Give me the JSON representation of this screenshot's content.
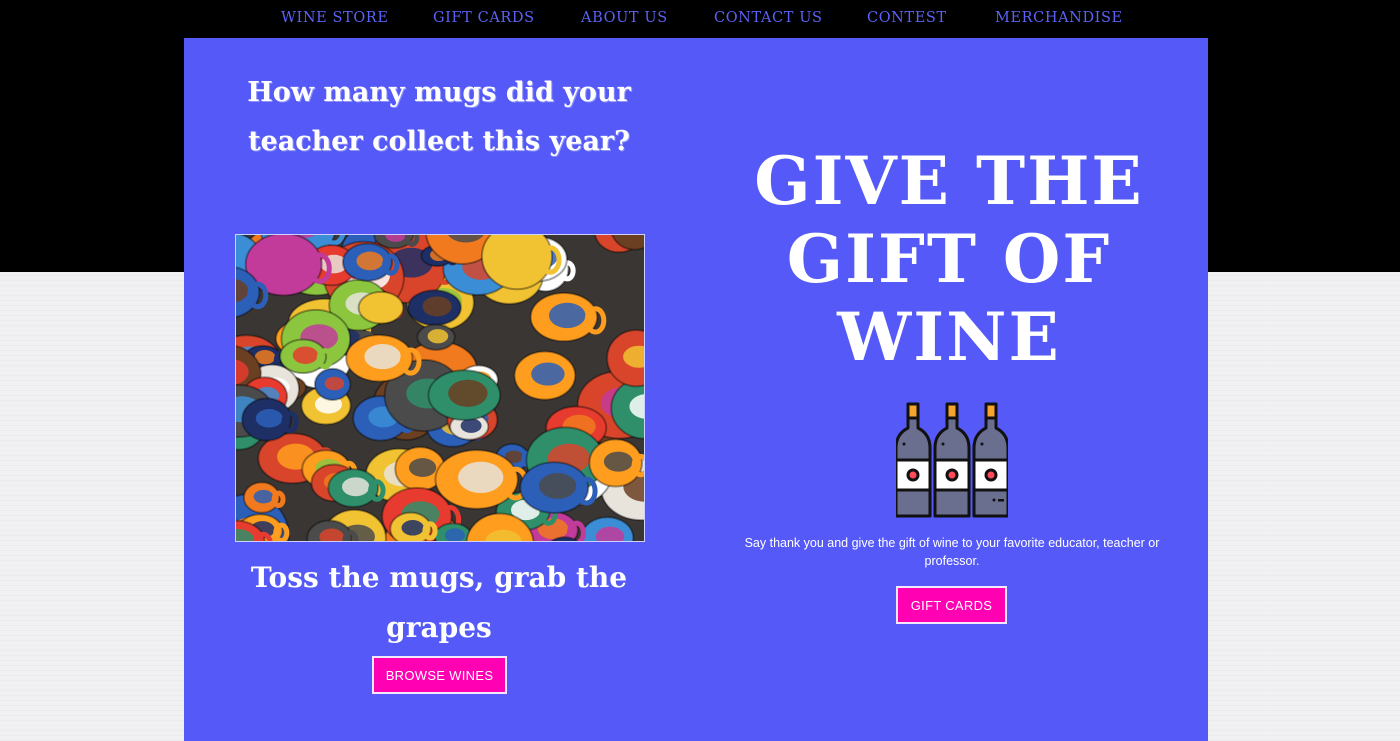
{
  "nav": {
    "items": [
      {
        "label": "WINE STORE"
      },
      {
        "label": "GIFT CARDS"
      },
      {
        "label": "ABOUT US"
      },
      {
        "label": "CONTACT US"
      },
      {
        "label": "CONTEST"
      },
      {
        "label": "MERCHANDISE"
      }
    ]
  },
  "left": {
    "question": "How many mugs did your teacher collect this year?",
    "tagline": "Toss the mugs, grab the grapes",
    "browse_button": "BROWSE WINES"
  },
  "right": {
    "hero_title": "GIVE THE GIFT OF WINE",
    "description": "Say thank you and give the gift of wine to your favorite educator, teacher or professor.",
    "gift_button": "GIFT CARDS"
  },
  "colors": {
    "panel": "#5459f7",
    "nav_text": "#5b62f5",
    "button": "#ff00b3",
    "top_band": "#000000"
  }
}
